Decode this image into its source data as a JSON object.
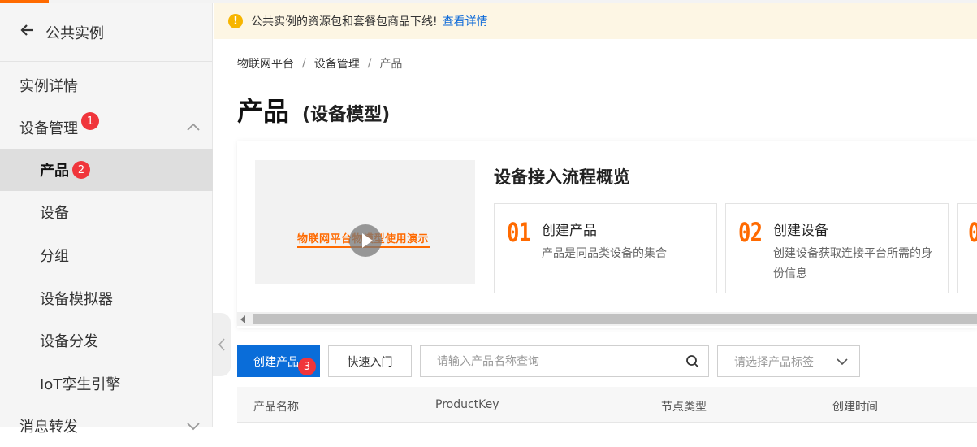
{
  "sidebar": {
    "back_label": "公共实例",
    "items": [
      {
        "label": "实例详情"
      },
      {
        "label": "设备管理",
        "badge": "1"
      },
      {
        "label": "产品",
        "badge": "2"
      },
      {
        "label": "设备"
      },
      {
        "label": "分组"
      },
      {
        "label": "设备模拟器"
      },
      {
        "label": "设备分发"
      },
      {
        "label": "IoT孪生引擎"
      },
      {
        "label": "消息转发"
      }
    ]
  },
  "notice": {
    "text": "公共实例的资源包和套餐包商品下线!",
    "link": "查看详情"
  },
  "breadcrumb": [
    "物联网平台",
    "设备管理",
    "产品"
  ],
  "page": {
    "title": "产品",
    "subtitle": "(设备模型)"
  },
  "overview": {
    "video_title": "物联网平台物模型使用演示",
    "title": "设备接入流程概览",
    "steps": [
      {
        "num": "01",
        "name": "创建产品",
        "desc": "产品是同品类设备的集合"
      },
      {
        "num": "02",
        "name": "创建设备",
        "desc": "创建设备获取连接平台所需的身份信息"
      },
      {
        "num": "0"
      }
    ]
  },
  "toolbar": {
    "create_label": "创建产品",
    "create_badge": "3",
    "quickstart_label": "快速入门",
    "search_placeholder": "请输入产品名称查询",
    "tag_placeholder": "请选择产品标签"
  },
  "table": {
    "columns": [
      "产品名称",
      "ProductKey",
      "节点类型",
      "创建时间"
    ]
  },
  "colors": {
    "accent": "#0a6dd9",
    "orange": "#ff6a00",
    "badge": "#f0353b",
    "notice_bg": "#fdf6e4"
  }
}
